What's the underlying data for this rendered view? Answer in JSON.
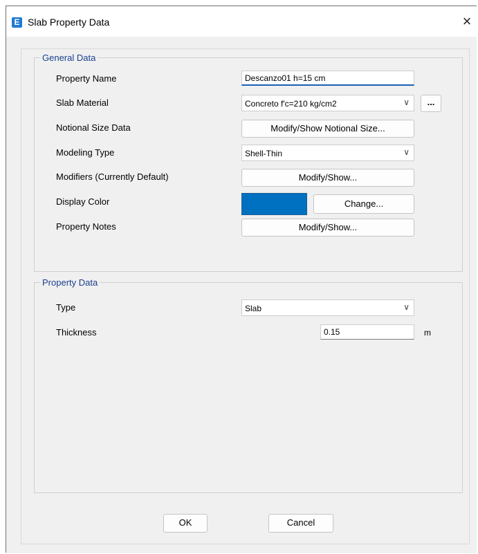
{
  "window": {
    "title": "Slab Property Data",
    "app_icon_letter": "E",
    "close_glyph": "×"
  },
  "general": {
    "header": "General Data",
    "property_name_label": "Property Name",
    "property_name_value": "Descanzo01 h=15 cm",
    "slab_material_label": "Slab Material",
    "slab_material_value": "Concreto f'c=210 kg/cm2",
    "ellipsis_label": "...",
    "notional_label": "Notional Size Data",
    "notional_button": "Modify/Show Notional Size...",
    "modeling_label": "Modeling Type",
    "modeling_value": "Shell-Thin",
    "modifiers_label": "Modifiers (Currently Default)",
    "modifiers_button": "Modify/Show...",
    "display_color_label": "Display Color",
    "display_color_hex": "#0071c0",
    "change_button": "Change...",
    "notes_label": "Property Notes",
    "notes_button": "Modify/Show..."
  },
  "property": {
    "header": "Property Data",
    "type_label": "Type",
    "type_value": "Slab",
    "thickness_label": "Thickness",
    "thickness_value": "0.15",
    "thickness_unit": "m"
  },
  "footer": {
    "ok_label": "OK",
    "cancel_label": "Cancel"
  }
}
